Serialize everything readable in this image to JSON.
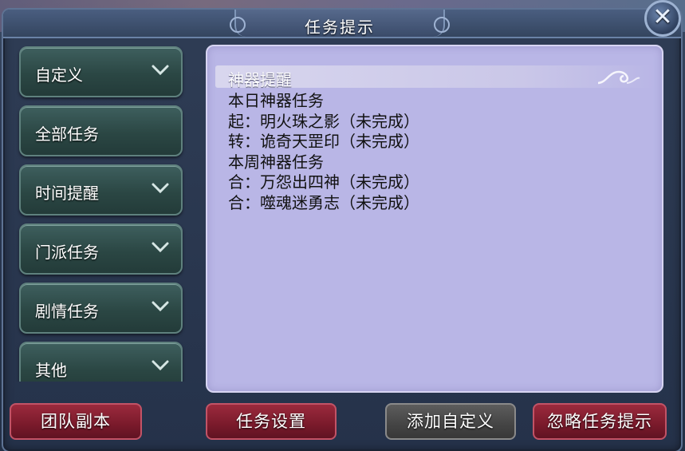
{
  "window": {
    "title": "任务提示",
    "close_label": "✕"
  },
  "menu": {
    "items": [
      {
        "label": "自定义",
        "has_dropdown": true
      },
      {
        "label": "全部任务",
        "has_dropdown": false
      },
      {
        "label": "时间提醒",
        "has_dropdown": true
      },
      {
        "label": "门派任务",
        "has_dropdown": true
      },
      {
        "label": "剧情任务",
        "has_dropdown": true
      },
      {
        "label": "其他",
        "has_dropdown": true
      }
    ]
  },
  "panel": {
    "header": "神器提醒",
    "lines": [
      "本日神器任务",
      "起：明火珠之影（未完成）",
      "转：诡奇天罡印（未完成）",
      "本周神器任务",
      "合：万怨出四神（未完成）",
      "合：噬魂迷勇志（未完成）"
    ]
  },
  "buttons": {
    "team_dungeon": "团队副本",
    "task_settings": "任务设置",
    "add_custom": "添加自定义",
    "ignore_hint": "忽略任务提示"
  }
}
